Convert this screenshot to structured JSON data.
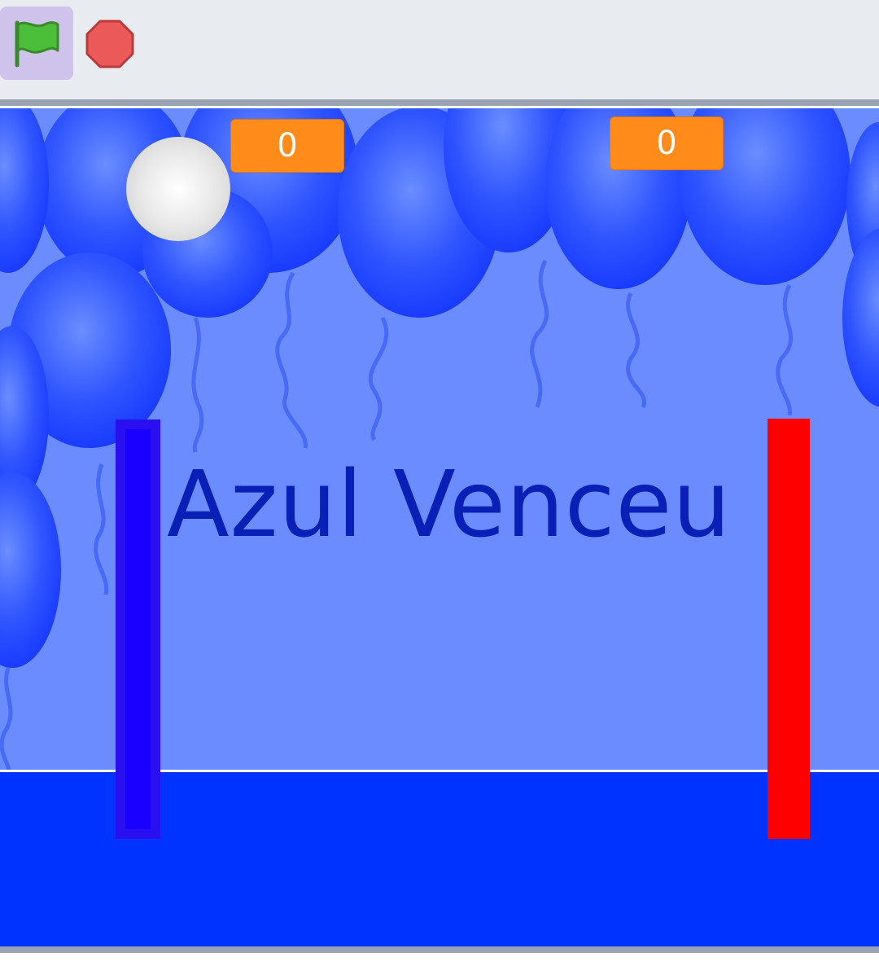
{
  "toolbar": {
    "green_flag_icon": "green-flag-icon",
    "stop_icon": "stop-icon"
  },
  "stage": {
    "background_color": "#6a8cff",
    "ground_color": "#0033ff",
    "message": "Azul Venceu",
    "score_left": "0",
    "score_right": "0",
    "blue_paddle_color": "#1a00ff",
    "red_paddle_color": "#ff0000",
    "ball_color": "#e6e6e6"
  }
}
